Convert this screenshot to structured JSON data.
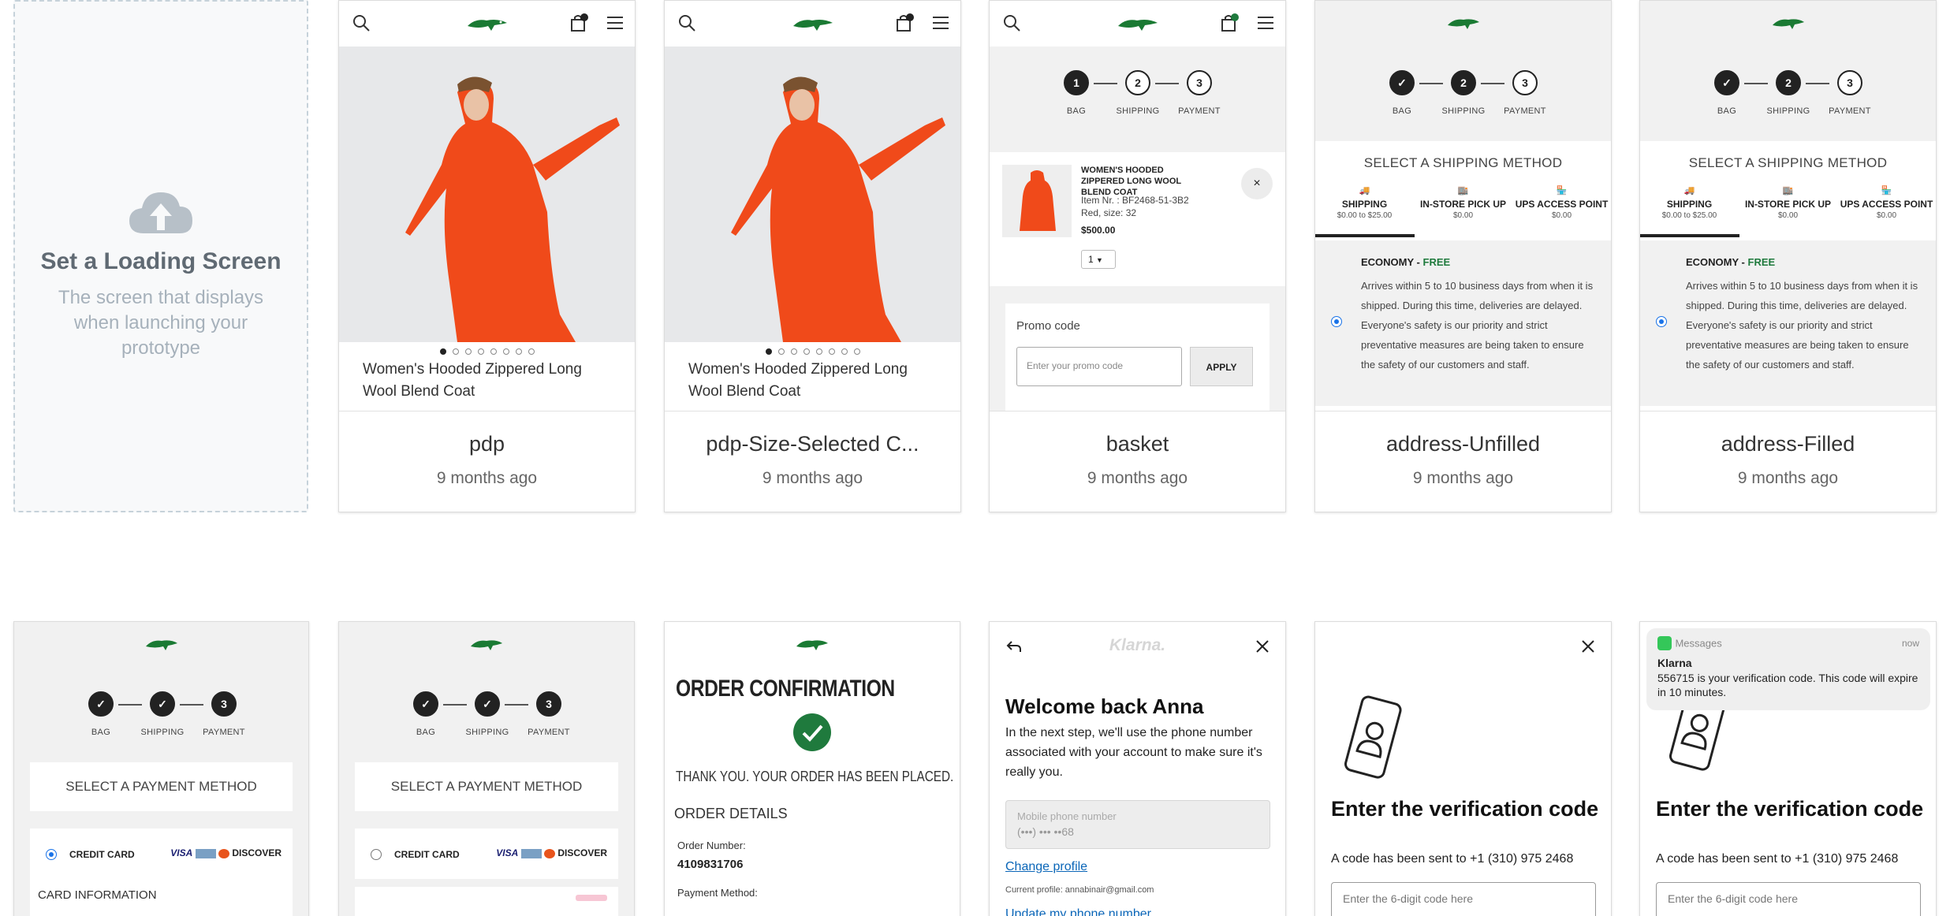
{
  "loading": {
    "title": "Set a Loading Screen",
    "subtitle": "The screen that displays when launching your prototype"
  },
  "screens": [
    {
      "name": "pdp",
      "time": "9 months ago"
    },
    {
      "name": "pdp-Size-Selected C...",
      "time": "9 months ago"
    },
    {
      "name": "basket",
      "time": "9 months ago"
    },
    {
      "name": "address-Unfilled",
      "time": "9 months ago"
    },
    {
      "name": "address-Filled",
      "time": "9 months ago"
    }
  ],
  "pdp": {
    "product_name": "Women's Hooded Zippered Long Wool Blend Coat",
    "badge": "0"
  },
  "basket": {
    "item_title": "WOMEN'S HOODED ZIPPERED LONG WOOL BLEND COAT",
    "item_nr": "Item Nr. : BF2468-51-3B2",
    "item_attr": "Red, size: 32",
    "price": "$500.00",
    "qty": "1",
    "promo_label": "Promo code",
    "promo_placeholder": "Enter your promo code",
    "apply": "APPLY"
  },
  "steps": {
    "bag": "BAG",
    "shipping": "SHIPPING",
    "payment": "PAYMENT",
    "n1": "1",
    "n2": "2",
    "n3": "3"
  },
  "shipping": {
    "title": "SELECT A SHIPPING METHOD",
    "tabs": [
      {
        "label": "SHIPPING",
        "price": "$0.00 to $25.00"
      },
      {
        "label": "IN-STORE PICK UP",
        "price": "$0.00"
      },
      {
        "label": "UPS ACCESS POINT",
        "price": "$0.00"
      }
    ],
    "econ": "ECONOMY -",
    "free": "FREE",
    "desc": "Arrives within 5 to 10 business days from when it is shipped. During this time, deliveries are delayed. Everyone's safety is our priority and strict preventative measures are being taken to ensure the safety of our customers and staff."
  },
  "payment": {
    "title": "SELECT A PAYMENT METHOD",
    "credit": "CREDIT CARD",
    "card_info": "CARD INFORMATION",
    "visa": "VISA",
    "discover": "DISCOVER"
  },
  "confirm": {
    "title": "ORDER CONFIRMATION",
    "thanks": "THANK YOU. YOUR ORDER HAS BEEN PLACED.",
    "details": "ORDER DETAILS",
    "order_number_label": "Order Number:",
    "order_number": "4109831706",
    "payment_label": "Payment Method:"
  },
  "klarna": {
    "brand": "Klarna.",
    "welcome": "Welcome back Anna",
    "desc": "In the next step, we'll use the phone number associated with your account to make sure it's really you.",
    "phone_label": "Mobile phone number",
    "phone_value": "(•••) ••• ••68",
    "change": "Change profile",
    "current": "Current profile: annabinair@gmail.com",
    "update": "Update my phone number"
  },
  "verify": {
    "title": "Enter the verification code",
    "sent": "A code has been sent to +1 (310) 975 2468",
    "placeholder": "Enter the 6-digit code here"
  },
  "sms": {
    "app": "Messages",
    "when": "now",
    "from": "Klarna",
    "msg": "556715 is your verification code. This code will expire in 10 minutes."
  },
  "colors": {
    "accent_green": "#1f7a3d",
    "coat": "#f04a1a",
    "radio_blue": "#1a73e8"
  }
}
